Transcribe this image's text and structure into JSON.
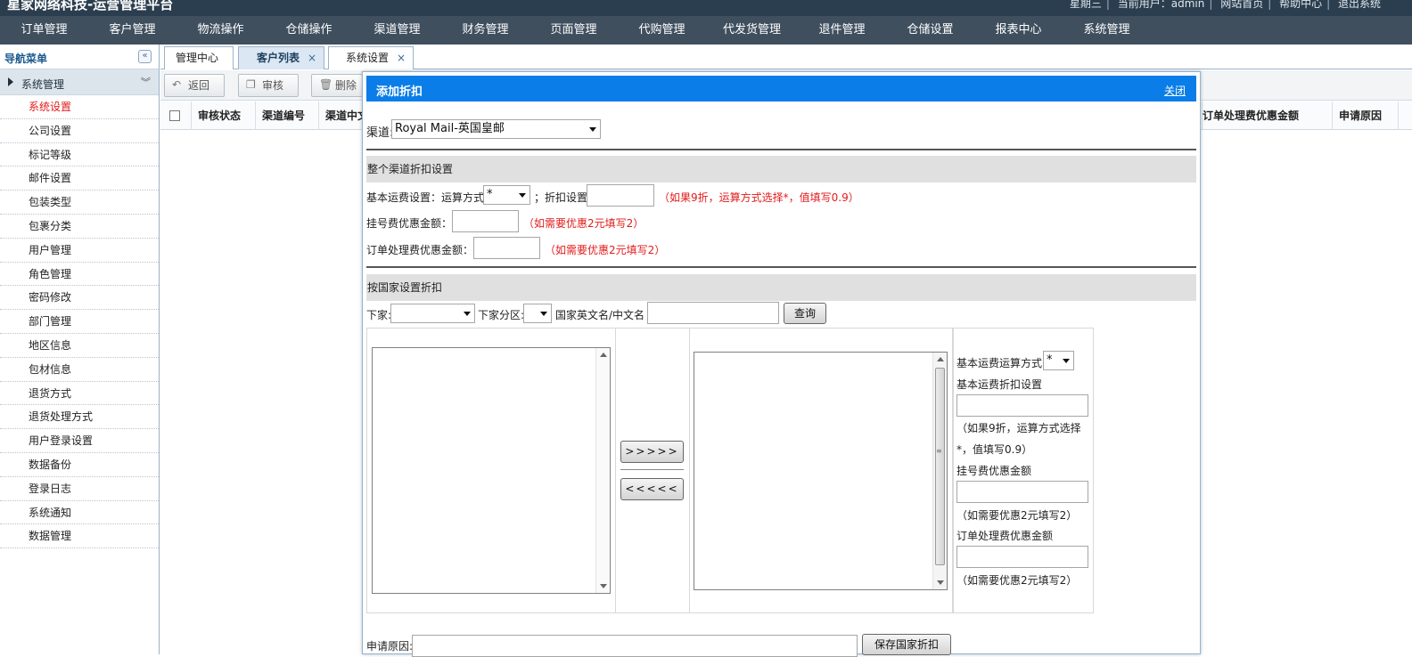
{
  "app": {
    "title": "星家网络科技-运营管理平台",
    "weekday": "星期三",
    "current_user_label": "当前用户：admin",
    "site_home": "网站首页",
    "help_center": "帮助中心",
    "logout": "退出系统"
  },
  "mainnav": [
    "订单管理",
    "客户管理",
    "物流操作",
    "仓储操作",
    "渠道管理",
    "财务管理",
    "页面管理",
    "代购管理",
    "代发货管理",
    "退件管理",
    "仓储设置",
    "报表中心",
    "系统管理"
  ],
  "sidebar": {
    "header": "导航菜单",
    "collapse_icon": "«",
    "group": "系统管理",
    "group_chev": "︾",
    "items": [
      "系统设置",
      "公司设置",
      "标记等级",
      "邮件设置",
      "包装类型",
      "包裹分类",
      "用户管理",
      "角色管理",
      "密码修改",
      "部门管理",
      "地区信息",
      "包材信息",
      "退货方式",
      "退货处理方式",
      "用户登录设置",
      "数据备份",
      "登录日志",
      "系统通知",
      "数据管理"
    ],
    "active_item": "系统设置"
  },
  "tabs": [
    {
      "label": "管理中心"
    },
    {
      "label": "客户列表",
      "close": "×"
    },
    {
      "label": "系统设置",
      "close": "×"
    }
  ],
  "toolbar": {
    "back": "返回",
    "audit": "审核",
    "delete": "删除"
  },
  "grid": {
    "columns_left": [
      "审核状态",
      "渠道编号",
      "渠道中文"
    ],
    "columns_right": [
      "订单处理费优惠金额",
      "申请原因"
    ]
  },
  "modal": {
    "title": "添加折扣",
    "close": "关闭",
    "channel_label": "渠道:",
    "channel_value": "Royal Mail-英国皇邮",
    "section1": "整个渠道折扣设置",
    "base_fee_label": "基本运费设置：运算方式",
    "base_fee_op": "*",
    "discount_label": "；折扣设置",
    "discount_hint": "（如果9折，运算方式选择*，值填写0.9）",
    "reg_fee_label": "挂号费优惠金额：",
    "reg_fee_hint": "（如需要优惠2元填写2）",
    "order_fee_label": "订单处理费优惠金额：",
    "order_fee_hint": "（如需要优惠2元填写2）",
    "section2": "按国家设置折扣",
    "customer_label": "下家:",
    "customer_zone_label": "下家分区:",
    "country_name_label": "国家英文名/中文名",
    "query_button": "查询",
    "move_right": ">>>>>",
    "move_left": "<<<<<",
    "right_base_op_label": "基本运费运算方式",
    "right_base_op_value": "*",
    "right_discount_label": "基本运费折扣设置",
    "right_discount_hint": "（如果9折，运算方式选择*，值填写0.9）",
    "right_reg_label": "挂号费优惠金额",
    "right_reg_hint": "（如需要优惠2元填写2）",
    "right_order_label": "订单处理费优惠金额",
    "right_order_hint": "（如需要优惠2元填写2）",
    "reason_label": "申请原因:",
    "save_country_button": "保存国家折扣"
  }
}
